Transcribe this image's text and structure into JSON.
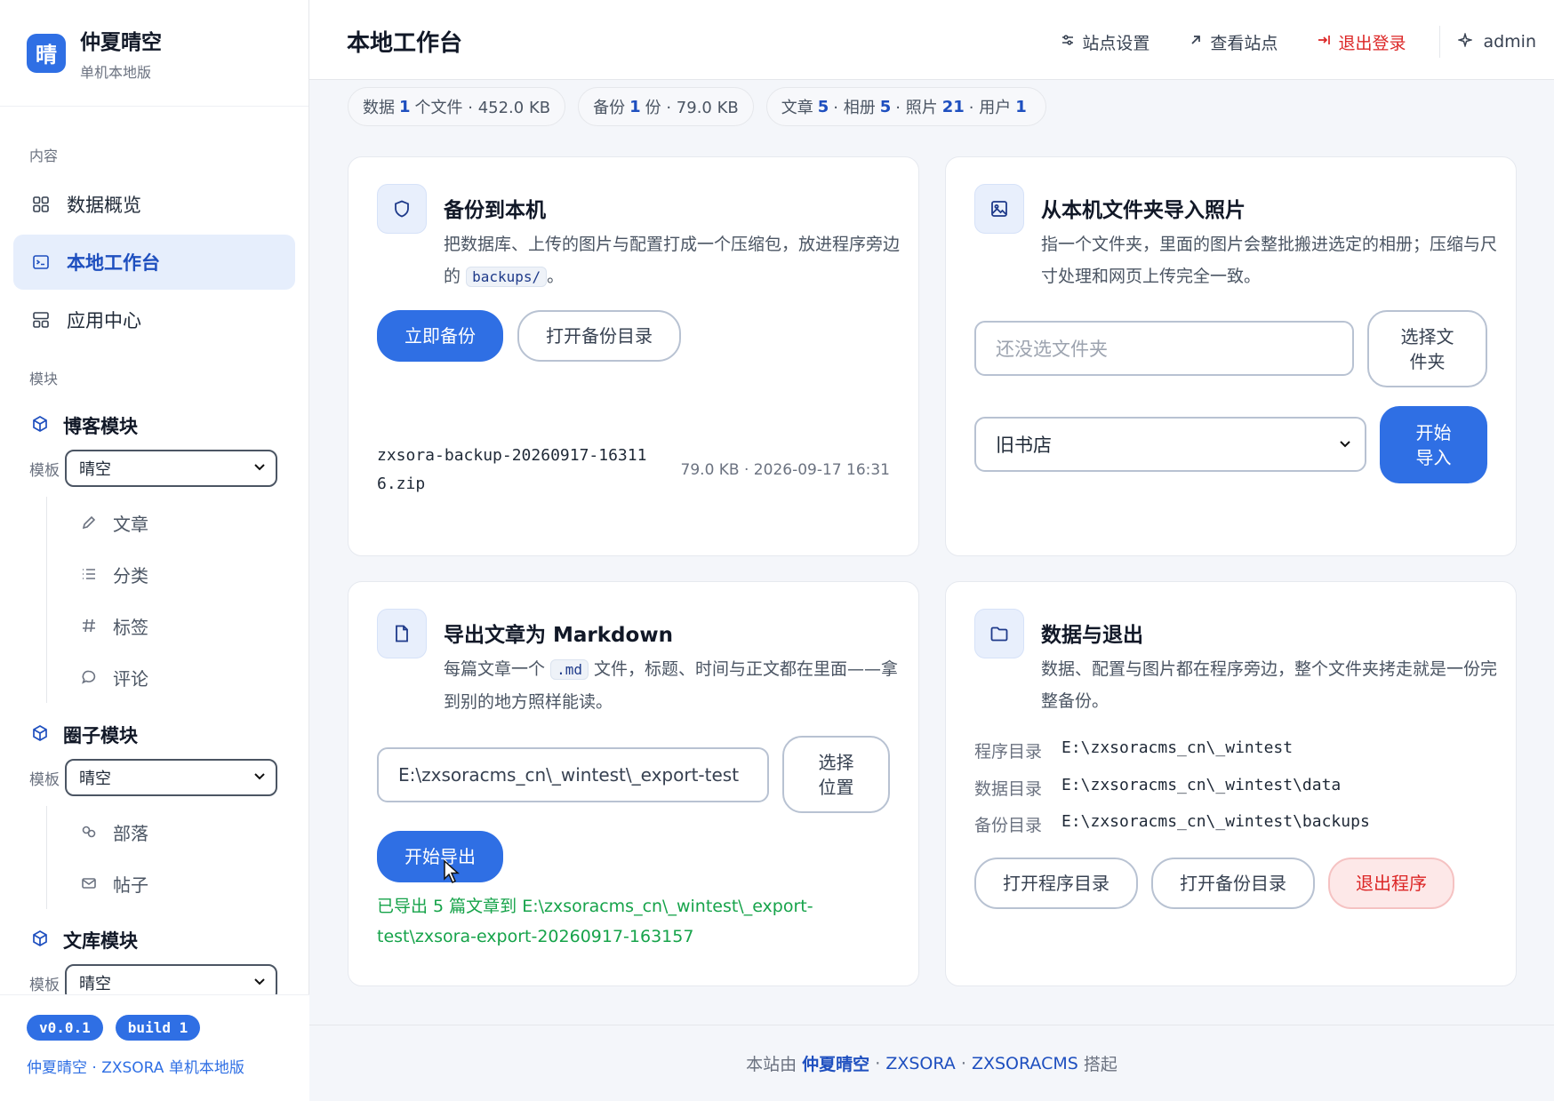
{
  "brand": {
    "logo_char": "晴",
    "title": "仲夏晴空",
    "subtitle": "单机本地版"
  },
  "sidebar": {
    "section_content": "内容",
    "nav": [
      {
        "label": "数据概览",
        "icon": "grid-icon"
      },
      {
        "label": "本地工作台",
        "icon": "terminal-icon",
        "active": true
      },
      {
        "label": "应用中心",
        "icon": "apps-icon"
      }
    ],
    "section_modules": "模块",
    "template_label": "模板",
    "modules": [
      {
        "name": "博客模块",
        "template": "晴空",
        "items": [
          "文章",
          "分类",
          "标签",
          "评论"
        ]
      },
      {
        "name": "圈子模块",
        "template": "晴空",
        "items": [
          "部落",
          "帖子"
        ]
      },
      {
        "name": "文库模块",
        "template": "晴空",
        "items": []
      }
    ],
    "version": "v0.0.1",
    "build": "build 1",
    "credit": "仲夏晴空 · ZXSORA 单机本地版"
  },
  "header": {
    "title": "本地工作台",
    "site_settings": "站点设置",
    "view_site": "查看站点",
    "logout": "退出登录",
    "user": "admin"
  },
  "stats": {
    "data_prefix": "数据",
    "data_count": "1",
    "data_suffix": "个文件 · 452.0 KB",
    "backup_prefix": "备份",
    "backup_count": "1",
    "backup_suffix": "份 · 79.0 KB",
    "posts_label": "文章",
    "posts": "5",
    "albums_label": "· 相册",
    "albums": "5",
    "photos_label": "· 照片",
    "photos": "21",
    "users_label": "· 用户",
    "users": "1"
  },
  "backup_card": {
    "title": "备份到本机",
    "desc_a": "把数据库、上传的图片与配置打成一个压缩包，放进程序旁边的",
    "desc_code": "backups/",
    "desc_b": "。",
    "btn_backup": "立即备份",
    "btn_open": "打开备份目录",
    "file_line1": "zxsora-backup-20260917-16311",
    "file_line2": "6.zip",
    "file_meta": "79.0 KB · 2026-09-17 16:31"
  },
  "import_card": {
    "title": "从本机文件夹导入照片",
    "desc": "指一个文件夹，里面的图片会整批搬进选定的相册；压缩与尺寸处理和网页上传完全一致。",
    "folder_placeholder": "还没选文件夹",
    "btn_choose_l1": "选择文",
    "btn_choose_l2": "件夹",
    "album_selected": "旧书店",
    "btn_import_l1": "开始",
    "btn_import_l2": "导入"
  },
  "export_card": {
    "title": "导出文章为 Markdown",
    "desc_a": "每篇文章一个",
    "desc_code": ".md",
    "desc_b": "文件，标题、时间与正文都在里面——拿到别的地方照样能读。",
    "path_value": "E:\\zxsoracms_cn\\_wintest\\_export-test",
    "btn_choose_l1": "选择",
    "btn_choose_l2": "位置",
    "btn_export": "开始导出",
    "result": "已导出 5 篇文章到 E:\\zxsoracms_cn\\_wintest\\_export-test\\zxsora-export-20260917-163157"
  },
  "data_card": {
    "title": "数据与退出",
    "desc": "数据、配置与图片都在程序旁边，整个文件夹拷走就是一份完整备份。",
    "paths": [
      {
        "k": "程序目录",
        "v": "E:\\zxsoracms_cn\\_wintest"
      },
      {
        "k": "数据目录",
        "v": "E:\\zxsoracms_cn\\_wintest\\data"
      },
      {
        "k": "备份目录",
        "v": "E:\\zxsoracms_cn\\_wintest\\backups"
      }
    ],
    "btn_open_program": "打开程序目录",
    "btn_open_backup": "打开备份目录",
    "btn_quit": "退出程序"
  },
  "footer": {
    "prefix": "本站由",
    "name": "仲夏晴空",
    "sep1": "·",
    "link1": "ZXSORA",
    "sep2": "·",
    "link2": "ZXSORACMS",
    "suffix": "搭起"
  }
}
